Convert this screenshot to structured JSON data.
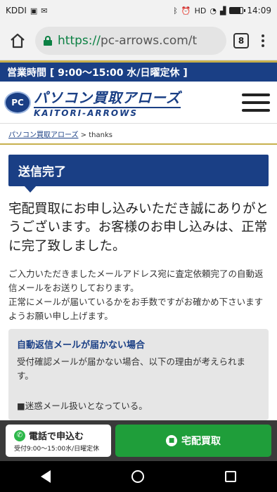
{
  "status_bar": {
    "carrier": "KDDI",
    "icons_left": [
      "app-icon",
      "mail-icon"
    ],
    "icons_right": [
      "bluetooth-icon",
      "alarm-icon",
      "hd-icon",
      "wifi-icon",
      "signal-icon",
      "battery-icon"
    ],
    "battery_level": 0.8,
    "time": "14:09"
  },
  "browser": {
    "url_scheme": "https://",
    "url_rest": "pc-arrows.com/t",
    "tab_count": "8"
  },
  "hours_banner": "営業時間 [ 9:00～15:00 水/日曜定休 ]",
  "header": {
    "logo_badge": "PC",
    "logo_jp": "パソコン買取アローズ",
    "logo_en": "KAITORI-ARROWS"
  },
  "breadcrumb": {
    "home_link": "パソコン買取アローズ",
    "separator": " > ",
    "current": "thanks"
  },
  "main": {
    "heading": "送信完了",
    "lead": "宅配買取にお申し込みいただき誠にありがとうございます。お客様のお申し込みは、正常に完了致しました。",
    "desc_1": "ご入力いただきましたメールアドレス宛に査定依頼完了の自動返信メールをお送りしております。",
    "desc_2": "正常にメールが届いているかをお手数ですがお確かめ下さいますようお願い申し上げます。",
    "notice_title": "自動返信メールが届かない場合",
    "notice_body": "受付確認メールが届かない場合、以下の理由が考えられます。",
    "notice_item_1": "■迷惑メール扱いとなっている。"
  },
  "footer_cta": {
    "tel_label": "電話で申込む",
    "tel_sub": "受付9:00～15:00水/日曜定休",
    "home_label": "宅配買取"
  },
  "colors": {
    "brand_navy": "#1a3f85",
    "accent_gold": "#c7b04d",
    "cta_green": "#1f9e3a"
  }
}
